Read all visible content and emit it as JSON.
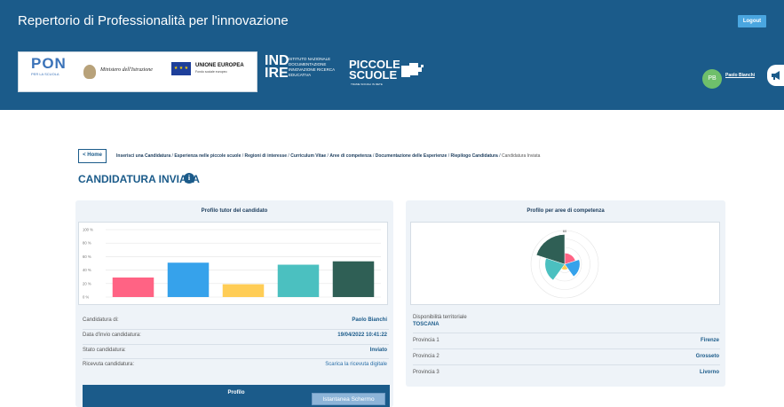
{
  "header": {
    "site_title": "Repertorio di Professionalità per l'innovazione",
    "logout_label": "Logout",
    "logos": {
      "pon": "PON",
      "pon_sub": "PER LA SCUOLA",
      "ministero": "Ministero dell'Istruzione",
      "eu_title": "UNIONE EUROPEA",
      "eu_sub": "Fondo sociale europeo",
      "indire_big": "IND IRE",
      "indire_small": "ISTITUTO NAZIONALE DOCUMENTAZIONE INNOVAZIONE RICERCA EDUCATIVA",
      "piccole_word": "PICCOLE SCUOLE",
      "piccole_sub": "TRAME SOCIALI IN RETE"
    },
    "user": {
      "initials": "PB",
      "name": "Paolo Bianchi"
    },
    "icons": {
      "megaphone": "megaphone-icon"
    }
  },
  "nav": {
    "home_label": "< Home",
    "breadcrumb": [
      "Inserisci una Candidatura",
      "Esperienza nelle piccole scuole",
      "Regioni di interesse",
      "Curriculum Vitae",
      "Aree di competenza",
      "Documentazione delle Esperienze",
      "Riepilogo Candidatura"
    ],
    "breadcrumb_current": "Candidatura Inviata",
    "separator": " / "
  },
  "page": {
    "title": "CANDIDATURA INVIATA",
    "info_icon": "i"
  },
  "tutor_card": {
    "title": "Profilo tutor del candidato",
    "rows": {
      "candidatura_label": "Candidatura di:",
      "candidatura_value": "Paolo Bianchi",
      "data_label": "Data d'invio candidatura:",
      "data_value": "19/04/2022 10:41:22",
      "stato_label": "Stato candidatura:",
      "stato_value": "Inviato",
      "ricevuta_label": "Ricevuta candidatura:",
      "ricevuta_value": "Scarica la ricevuta digitale"
    },
    "profilo_label": "Profilo",
    "istantanea_label": "Istantanea Schermo"
  },
  "aree_card": {
    "title": "Profilo per aree di competenza",
    "disponibilita_label": "Disponibilità territoriale",
    "disponibilita_value": "TOSCANA",
    "province": [
      {
        "label": "Provincia 1",
        "value": "Firenze"
      },
      {
        "label": "Provincia 2",
        "value": "Grosseto"
      },
      {
        "label": "Provincia 3",
        "value": "Livorno"
      }
    ]
  },
  "chart_data": [
    {
      "type": "bar",
      "categories": [
        "",
        "",
        "",
        "",
        ""
      ],
      "values": [
        29,
        51,
        19,
        48,
        53
      ],
      "colors": [
        "#ff6384",
        "#36a2eb",
        "#ffcd56",
        "#4bc0c0",
        "#2f5f55"
      ],
      "yticks": [
        "0 %",
        "20 %",
        "40 %",
        "60 %",
        "80 %",
        "100 %"
      ],
      "ylim": [
        0,
        100
      ],
      "grid": true
    },
    {
      "type": "polarArea",
      "values": [
        20,
        27,
        10,
        35,
        53
      ],
      "colors": [
        "#ff6384",
        "#36a2eb",
        "#ffcd56",
        "#4bc0c0",
        "#2f5f55"
      ],
      "rticks": [
        "60"
      ],
      "rlim": [
        0,
        60
      ]
    }
  ]
}
